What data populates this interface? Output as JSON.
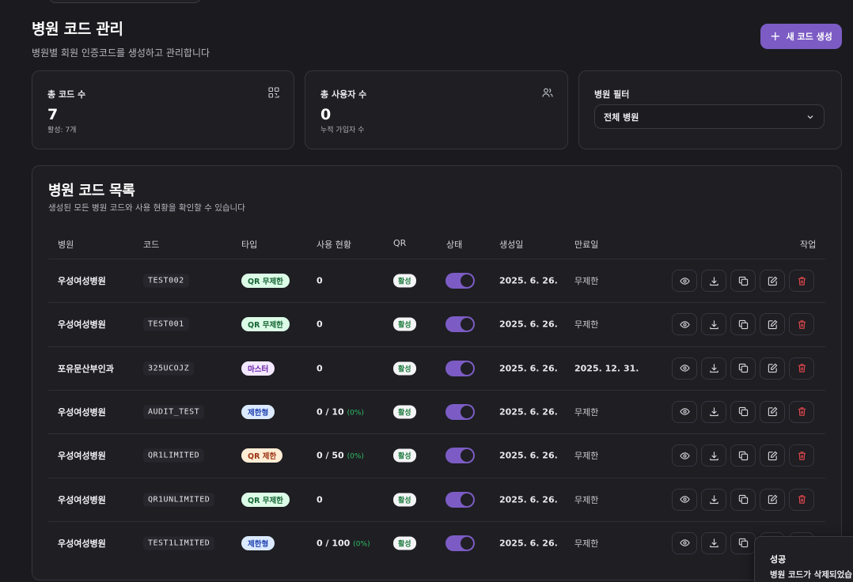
{
  "header": {
    "title": "병원 코드 관리",
    "subtitle": "병원별 회원 인증코드를 생성하고 관리합니다",
    "new_code_label": "새 코드 생성"
  },
  "stats": {
    "total_codes": {
      "label": "총 코드 수",
      "value": "7",
      "sub": "활성: 7개",
      "icon": "qr-code-icon"
    },
    "total_users": {
      "label": "총 사용자 수",
      "value": "0",
      "sub": "누적 가입자 수",
      "icon": "users-icon"
    },
    "filter": {
      "label": "병원 필터",
      "selected": "전체 병원",
      "icon": "chevron-down-icon"
    }
  },
  "list": {
    "title": "병원 코드 목록",
    "subtitle": "생성된 모든 병원 코드와 사용 현황을 확인할 수 있습니다",
    "columns": [
      "병원",
      "코드",
      "타입",
      "사용 현황",
      "QR",
      "상태",
      "생성일",
      "만료일",
      "작업"
    ],
    "rows": [
      {
        "hospital": "우성여성병원",
        "code": "TEST002",
        "type": "QR 무제한",
        "type_kind": "qr-unlimited",
        "usage": "0",
        "usage_pct": "",
        "qr": "활성",
        "active": true,
        "created": "2025. 6. 26.",
        "expires": "무제한"
      },
      {
        "hospital": "우성여성병원",
        "code": "TEST001",
        "type": "QR 무제한",
        "type_kind": "qr-unlimited",
        "usage": "0",
        "usage_pct": "",
        "qr": "활성",
        "active": true,
        "created": "2025. 6. 26.",
        "expires": "무제한"
      },
      {
        "hospital": "포유문산부인과",
        "code": "325UCOJZ",
        "type": "마스터",
        "type_kind": "master",
        "usage": "0",
        "usage_pct": "",
        "qr": "활성",
        "active": true,
        "created": "2025. 6. 26.",
        "expires": "2025. 12. 31."
      },
      {
        "hospital": "우성여성병원",
        "code": "AUDIT_TEST",
        "type": "제한형",
        "type_kind": "limited",
        "usage": "0 / 10",
        "usage_pct": "(0%)",
        "qr": "활성",
        "active": true,
        "created": "2025. 6. 26.",
        "expires": "무제한"
      },
      {
        "hospital": "우성여성병원",
        "code": "QR1LIMITED",
        "type": "QR 제한",
        "type_kind": "qr-limited",
        "usage": "0 / 50",
        "usage_pct": "(0%)",
        "qr": "활성",
        "active": true,
        "created": "2025. 6. 26.",
        "expires": "무제한"
      },
      {
        "hospital": "우성여성병원",
        "code": "QR1UNLIMITED",
        "type": "QR 무제한",
        "type_kind": "qr-unlimited",
        "usage": "0",
        "usage_pct": "",
        "qr": "활성",
        "active": true,
        "created": "2025. 6. 26.",
        "expires": "무제한"
      },
      {
        "hospital": "우성여성병원",
        "code": "TEST1LIMITED",
        "type": "제한형",
        "type_kind": "limited",
        "usage": "0 / 100",
        "usage_pct": "(0%)",
        "qr": "활성",
        "active": true,
        "created": "2025. 6. 26.",
        "expires": "무제한"
      }
    ],
    "actions": [
      "view-icon",
      "download-icon",
      "copy-icon",
      "edit-icon",
      "trash-icon"
    ]
  },
  "toast": {
    "title": "성공",
    "message": "병원 코드가 삭제되었습"
  },
  "colors": {
    "background": "#1b1b1f",
    "accent": "#7c5cc4",
    "qr_unlimited_bg": "#dcfce7",
    "qr_unlimited_fg": "#166534",
    "master_bg": "#f3e8ff",
    "master_fg": "#6b21a8",
    "limited_bg": "#dbeafe",
    "limited_fg": "#1e40af",
    "qr_limited_bg": "#ffedd5",
    "qr_limited_fg": "#9a3412",
    "danger": "#e5484d"
  }
}
